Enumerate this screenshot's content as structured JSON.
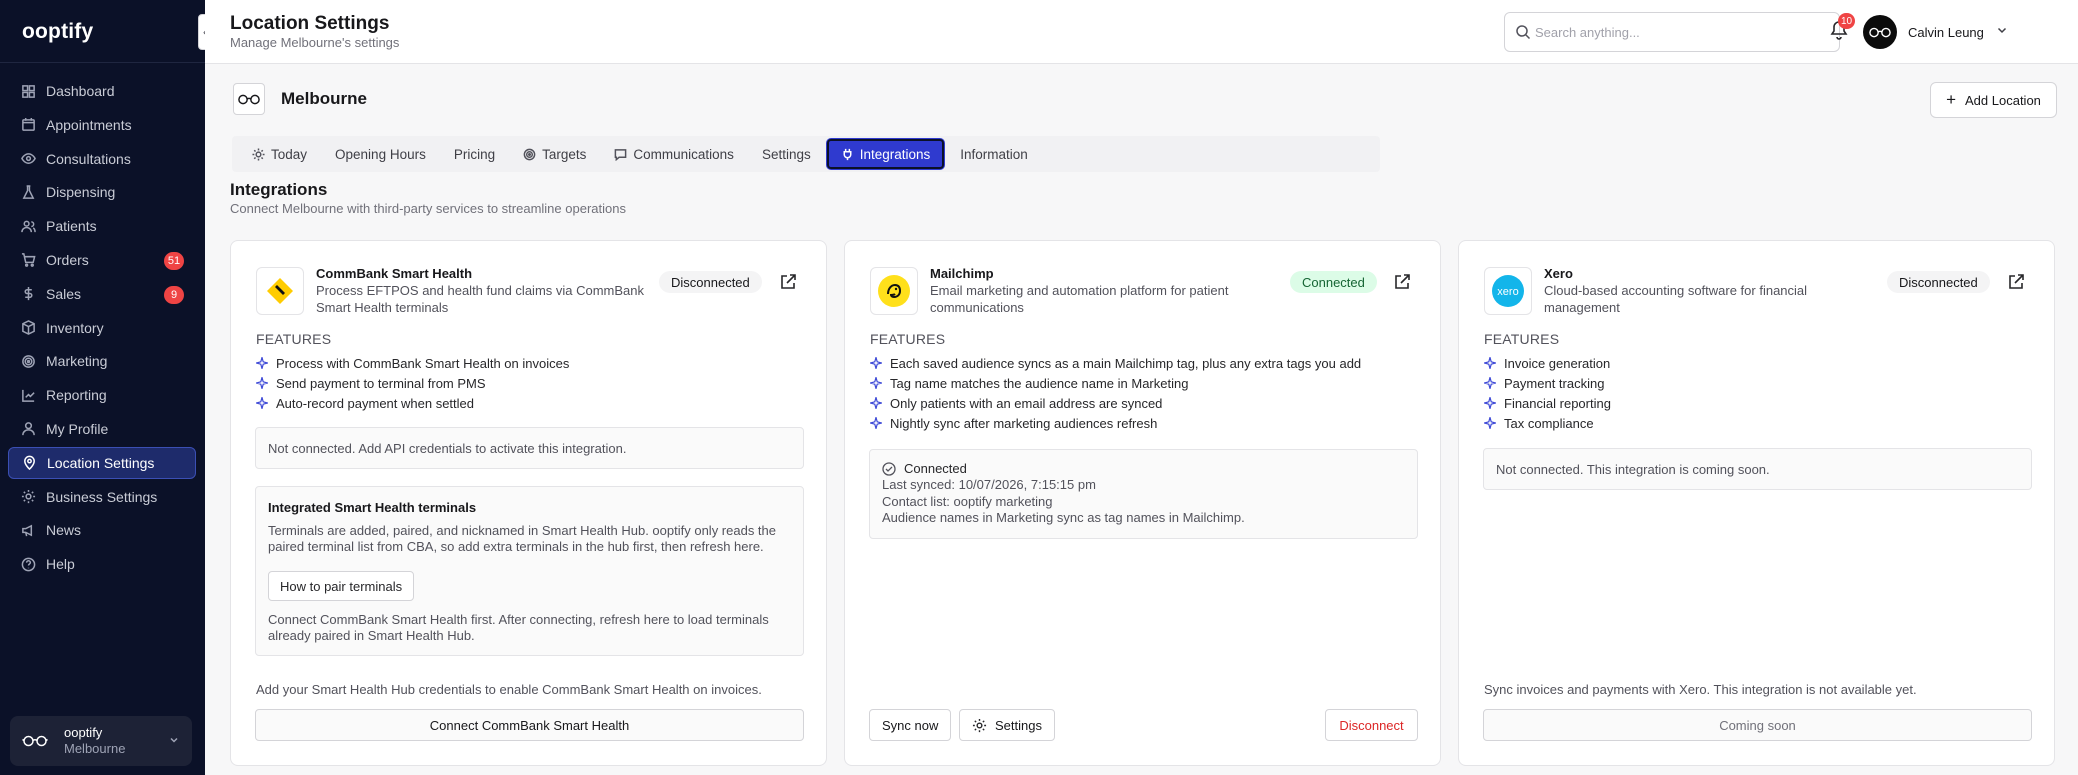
{
  "app": {
    "brand": "ooptify"
  },
  "sidebar": {
    "items": [
      {
        "label": "Dashboard",
        "icon": "dashboard-icon"
      },
      {
        "label": "Appointments",
        "icon": "calendar-icon"
      },
      {
        "label": "Consultations",
        "icon": "eye-icon"
      },
      {
        "label": "Dispensing",
        "icon": "flask-icon"
      },
      {
        "label": "Patients",
        "icon": "users-icon"
      },
      {
        "label": "Orders",
        "icon": "cart-icon",
        "badge": "51"
      },
      {
        "label": "Sales",
        "icon": "dollar-icon",
        "badge": "9"
      },
      {
        "label": "Inventory",
        "icon": "box-icon"
      },
      {
        "label": "Marketing",
        "icon": "target-icon"
      },
      {
        "label": "Reporting",
        "icon": "chart-icon"
      },
      {
        "label": "My Profile",
        "icon": "user-icon"
      },
      {
        "label": "Location Settings",
        "icon": "map-pin-icon",
        "active": true
      },
      {
        "label": "Business Settings",
        "icon": "gear-icon"
      },
      {
        "label": "News",
        "icon": "megaphone-icon"
      },
      {
        "label": "Help",
        "icon": "help-icon"
      }
    ],
    "user_card": {
      "name": "ooptify",
      "location": "Melbourne"
    }
  },
  "header": {
    "title": "Location Settings",
    "subtitle": "Manage Melbourne's settings",
    "search_placeholder": "Search anything...",
    "user_name": "Calvin Leung",
    "notifications": "10"
  },
  "location": {
    "name": "Melbourne",
    "add_label": "Add Location"
  },
  "tabs": [
    {
      "label": "Today",
      "icon": "sun-icon"
    },
    {
      "label": "Opening Hours"
    },
    {
      "label": "Pricing"
    },
    {
      "label": "Targets",
      "icon": "target-icon"
    },
    {
      "label": "Communications",
      "icon": "message-icon"
    },
    {
      "label": "Settings"
    },
    {
      "label": "Integrations",
      "icon": "plug-icon",
      "active": true
    },
    {
      "label": "Information"
    }
  ],
  "section": {
    "title": "Integrations",
    "subtitle": "Connect Melbourne with third-party services to streamline operations"
  },
  "integrations": {
    "commbank": {
      "name": "CommBank Smart Health",
      "description": "Process EFTPOS and health fund claims via CommBank Smart Health terminals",
      "status": "Disconnected",
      "features_heading": "FEATURES",
      "features": [
        "Process with CommBank Smart Health on invoices",
        "Send payment to terminal from PMS",
        "Auto-record payment when settled"
      ],
      "note": "Not connected. Add API credentials to activate this integration.",
      "terminals": {
        "title": "Integrated Smart Health terminals",
        "body": "Terminals are added, paired, and nicknamed in Smart Health Hub. ooptify only reads the paired terminal list from CBA, so add extra terminals in the hub first, then refresh here.",
        "button": "How to pair terminals",
        "footer": "Connect CommBank Smart Health first. After connecting, refresh here to load terminals already paired in Smart Health Hub."
      },
      "footer_text": "Add your Smart Health Hub credentials to enable CommBank Smart Health on invoices.",
      "action": "Connect CommBank Smart Health",
      "brand_color": "#ffcc00"
    },
    "mailchimp": {
      "name": "Mailchimp",
      "description": "Email marketing and automation platform for patient communications",
      "status": "Connected",
      "features_heading": "FEATURES",
      "features": [
        "Each saved audience syncs as a main Mailchimp tag, plus any extra tags you add",
        "Tag name matches the audience name in Marketing",
        "Only patients with an email address are synced",
        "Nightly sync after marketing audiences refresh"
      ],
      "connected": {
        "heading": "Connected",
        "last_synced": "Last synced: 10/07/2026, 7:15:15 pm",
        "contact_list": "Contact list: ooptify marketing",
        "audience_note": "Audience names in Marketing sync as tag names in Mailchimp."
      },
      "sync_label": "Sync now",
      "settings_label": "Settings",
      "disconnect_label": "Disconnect",
      "brand_color": "#ffe01b"
    },
    "xero": {
      "name": "Xero",
      "description": "Cloud-based accounting software for financial management",
      "status": "Disconnected",
      "features_heading": "FEATURES",
      "features": [
        "Invoice generation",
        "Payment tracking",
        "Financial reporting",
        "Tax compliance"
      ],
      "note": "Not connected. This integration is coming soon.",
      "footer_text": "Sync invoices and payments with Xero. This integration is not available yet.",
      "action": "Coming soon",
      "brand_color": "#13b5ea"
    }
  },
  "colors": {
    "sidebar_bg": "#0b1128",
    "accent": "#2f3acf",
    "danger": "#dc2626",
    "feature_icon": "#3b47d6"
  }
}
